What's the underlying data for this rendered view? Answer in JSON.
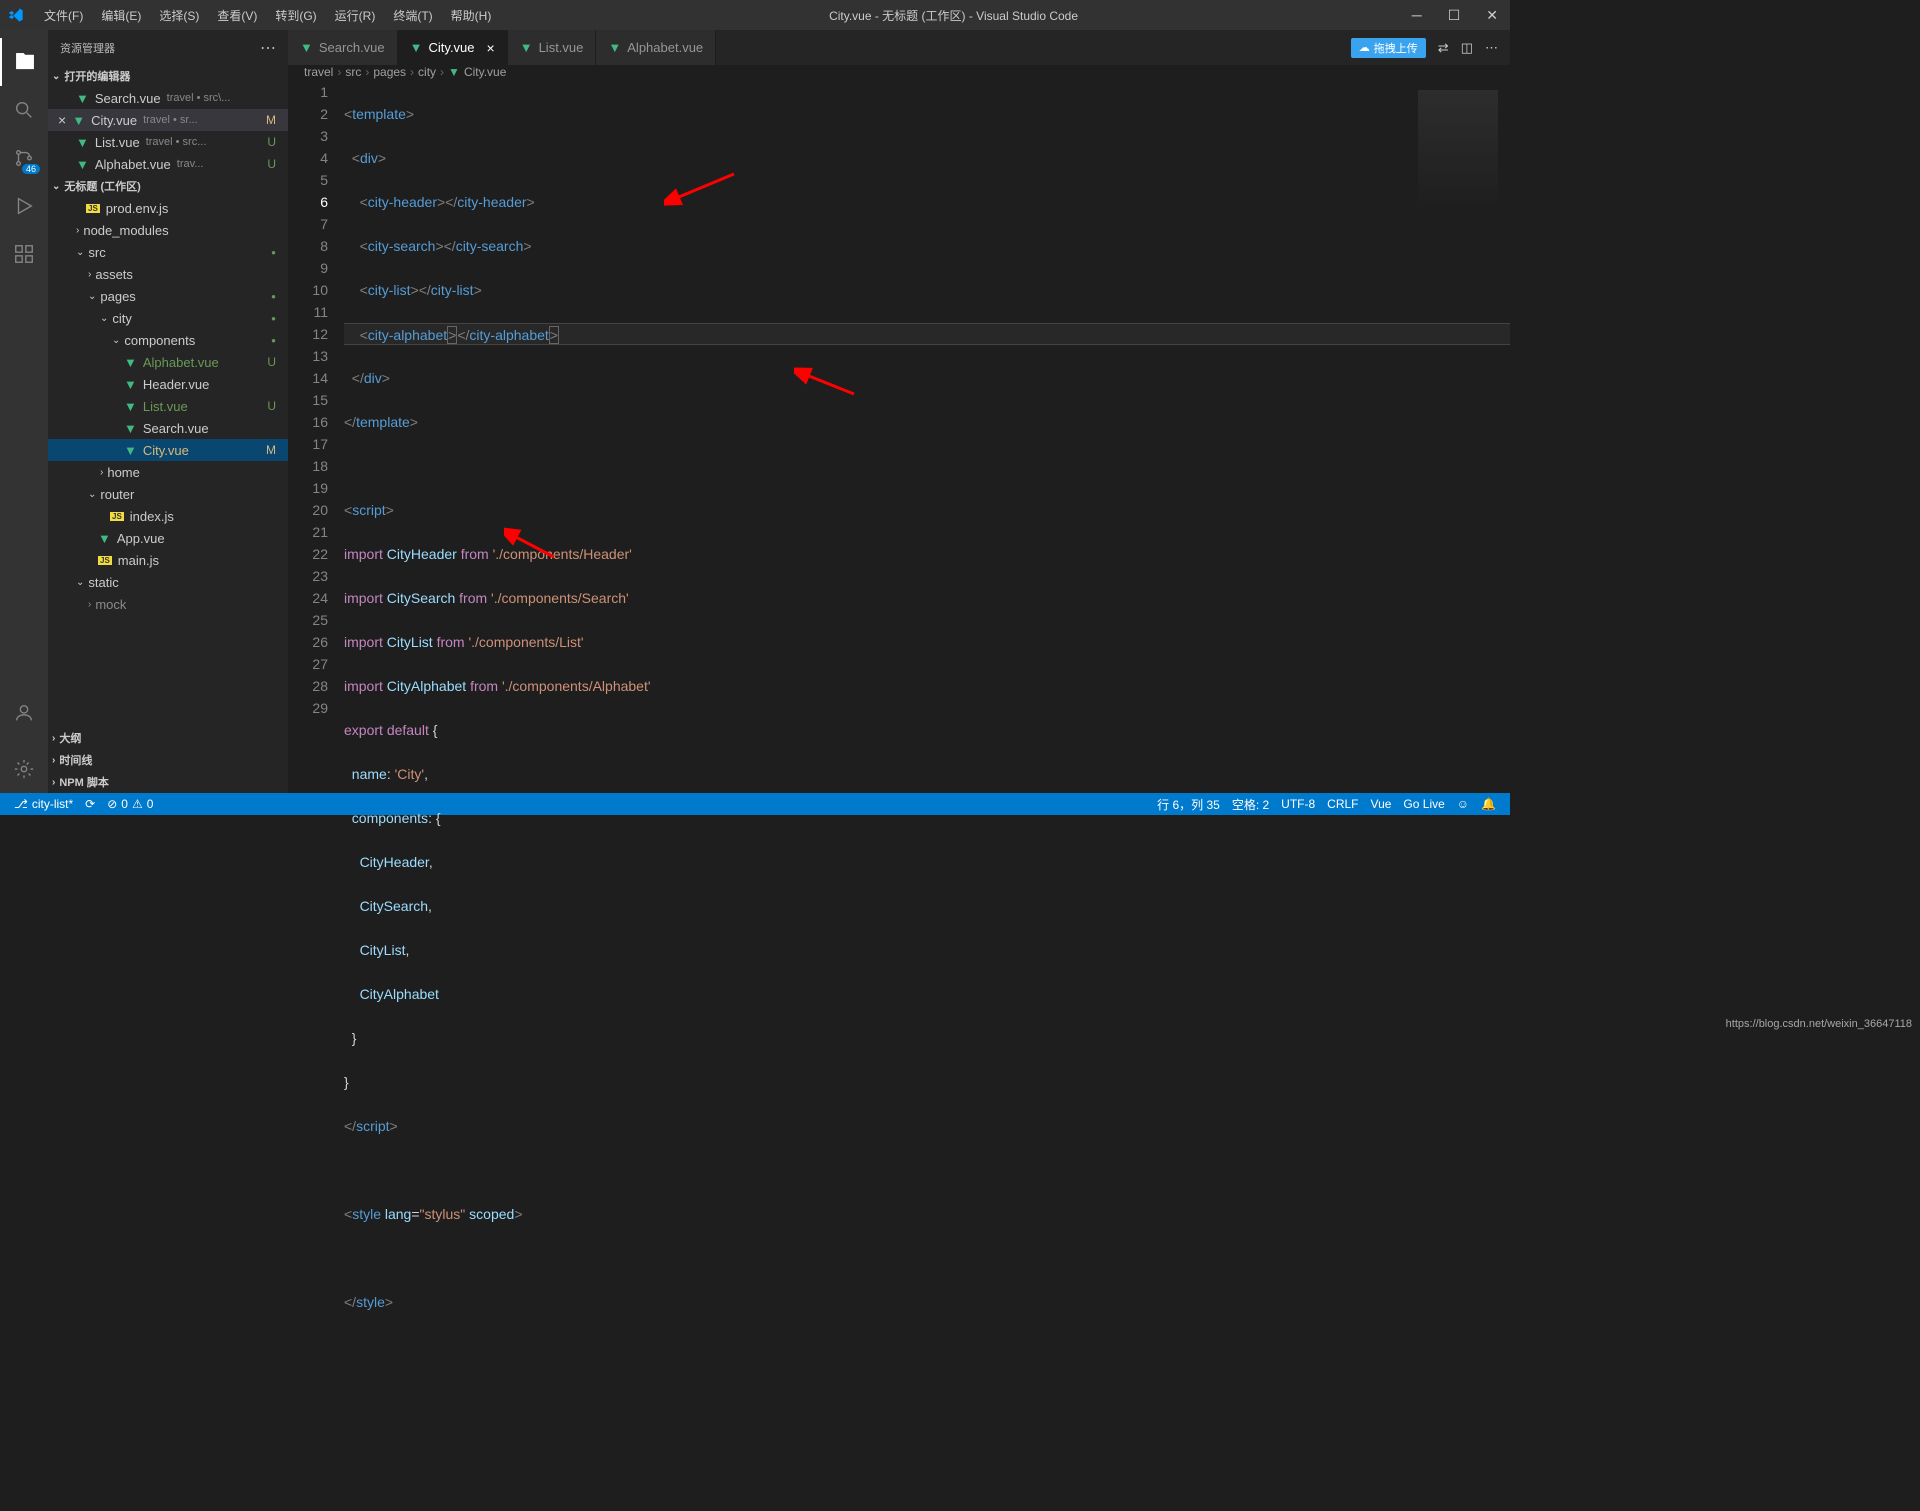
{
  "window": {
    "title": "City.vue - 无标题 (工作区) - Visual Studio Code"
  },
  "menu": {
    "file": "文件(F)",
    "edit": "编辑(E)",
    "select": "选择(S)",
    "view": "查看(V)",
    "goto": "转到(G)",
    "run": "运行(R)",
    "terminal": "终端(T)",
    "help": "帮助(H)"
  },
  "activitybar": {
    "badge": "46"
  },
  "sidebar": {
    "title": "资源管理器",
    "open_editors": "打开的编辑器",
    "workspace": "无标题 (工作区)",
    "outline": "大纲",
    "timeline": "时间线",
    "npm": "NPM 脚本",
    "editors": [
      {
        "name": "Search.vue",
        "detail": "travel • src\\...",
        "status": ""
      },
      {
        "name": "City.vue",
        "detail": "travel • sr...",
        "status": "M",
        "active": true
      },
      {
        "name": "List.vue",
        "detail": "travel • src...",
        "status": "U"
      },
      {
        "name": "Alphabet.vue",
        "detail": "trav...",
        "status": "U"
      }
    ],
    "tree": {
      "prod": "prod.env.js",
      "node_modules": "node_modules",
      "src": "src",
      "assets": "assets",
      "pages": "pages",
      "city": "city",
      "components": "components",
      "alphabet": "Alphabet.vue",
      "header": "Header.vue",
      "list": "List.vue",
      "search": "Search.vue",
      "cityvue": "City.vue",
      "home": "home",
      "router": "router",
      "indexjs": "index.js",
      "appvue": "App.vue",
      "mainjs": "main.js",
      "static": "static",
      "mock": "mock"
    }
  },
  "tabs": [
    {
      "name": "Search.vue"
    },
    {
      "name": "City.vue",
      "active": true
    },
    {
      "name": "List.vue"
    },
    {
      "name": "Alphabet.vue"
    }
  ],
  "upload": "拖拽上传",
  "breadcrumb": [
    "travel",
    "src",
    "pages",
    "city",
    "City.vue"
  ],
  "statusbar": {
    "branch": "city-list*",
    "errors": "0",
    "warnings": "0",
    "line_col": "行 6，列 35",
    "spaces": "空格: 2",
    "encoding": "UTF-8",
    "eol": "CRLF",
    "lang": "Vue",
    "golive": "Go Live",
    "feedback": ""
  },
  "watermark": "https://blog.csdn.net/weixin_36647118",
  "code": {
    "line1": {
      "open": "<",
      "tag": "template",
      "close": ">"
    },
    "line2": {
      "indent": "  ",
      "open": "<",
      "tag": "div",
      "close": ">"
    },
    "line3": {
      "indent": "    ",
      "open": "<",
      "tag1": "city-header",
      "mid": "></",
      "tag2": "city-header",
      "close": ">"
    },
    "line4": {
      "indent": "    ",
      "open": "<",
      "tag1": "city-search",
      "mid": "></",
      "tag2": "city-search",
      "close": ">"
    },
    "line5": {
      "indent": "    ",
      "open": "<",
      "tag1": "city-list",
      "mid": "></",
      "tag2": "city-list",
      "close": ">"
    },
    "line6": {
      "indent": "    ",
      "open": "<",
      "tag1": "city-alphabet",
      "mid1": ">",
      "mid2": "</",
      "tag2": "city-alphabet",
      "close": ">"
    },
    "line7": {
      "indent": "  ",
      "open": "</",
      "tag": "div",
      "close": ">"
    },
    "line8": {
      "open": "</",
      "tag": "template",
      "close": ">"
    },
    "line10": {
      "open": "<",
      "tag": "script",
      "close": ">"
    },
    "line11": {
      "kw1": "import",
      "cls": "CityHeader",
      "kw2": "from",
      "str": "'./components/Header'"
    },
    "line12": {
      "kw1": "import",
      "cls": "CitySearch",
      "kw2": "from",
      "str": "'./components/Search'"
    },
    "line13": {
      "kw1": "import",
      "cls": "CityList",
      "kw2": "from",
      "str": "'./components/List'"
    },
    "line14": {
      "kw1": "import",
      "cls": "CityAlphabet",
      "kw2": "from",
      "str": "'./components/Alphabet'"
    },
    "line15": {
      "kw1": "export",
      "kw2": "default",
      "brace": "{"
    },
    "line16": {
      "indent": "  ",
      "prop": "name",
      "colon": ": ",
      "str": "'City'",
      "comma": ","
    },
    "line17": {
      "indent": "  ",
      "prop": "components",
      "colon": ": {",
      "brace": ""
    },
    "line18": {
      "indent": "    ",
      "cls": "CityHeader",
      "comma": ","
    },
    "line19": {
      "indent": "    ",
      "cls": "CitySearch",
      "comma": ","
    },
    "line20": {
      "indent": "    ",
      "cls": "CityList",
      "comma": ","
    },
    "line21": {
      "indent": "    ",
      "cls": "CityAlphabet"
    },
    "line22": {
      "indent": "  ",
      "brace": "}"
    },
    "line23": {
      "brace": "}"
    },
    "line24": {
      "open": "</",
      "tag": "script",
      "close": ">"
    },
    "line26": {
      "open": "<",
      "tag": "style",
      "sp": " ",
      "attr1": "lang",
      "eq1": "=",
      "val1": "\"stylus\"",
      "sp2": " ",
      "attr2": "scoped",
      "close": ">"
    },
    "line28": {
      "open": "</",
      "tag": "style",
      "close": ">"
    }
  }
}
